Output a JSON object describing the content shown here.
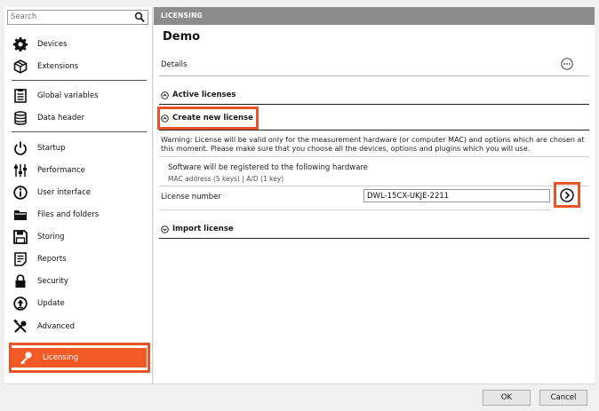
{
  "search": {
    "placeholder": "Search"
  },
  "sidebar": {
    "items": [
      {
        "label": "Devices",
        "icon": "gear-icon"
      },
      {
        "label": "Extensions",
        "icon": "package-icon"
      },
      {
        "label": "Global variables",
        "icon": "document-list-icon"
      },
      {
        "label": "Data header",
        "icon": "database-icon"
      },
      {
        "label": "Startup",
        "icon": "power-icon"
      },
      {
        "label": "Performance",
        "icon": "sliders-icon"
      },
      {
        "label": "User interface",
        "icon": "info-circle-icon"
      },
      {
        "label": "Files and folders",
        "icon": "folder-icon"
      },
      {
        "label": "Storing",
        "icon": "floppy-disk-icon"
      },
      {
        "label": "Reports",
        "icon": "report-icon"
      },
      {
        "label": "Security",
        "icon": "lock-icon"
      },
      {
        "label": "Update",
        "icon": "update-arrow-icon"
      },
      {
        "label": "Advanced",
        "icon": "tools-icon"
      },
      {
        "label": "Licensing",
        "icon": "key-icon"
      }
    ]
  },
  "main": {
    "header": "LICENSING",
    "title": "Demo",
    "details": "Details",
    "sections": {
      "active": "Active licenses",
      "create": "Create new license",
      "import": "Import license"
    },
    "warning": "Warning: License will be valid only for the measurement hardware (or computer MAC) and options which are chosen at this moment. Please make sure that you choose all the devices, options and plugins which you will use.",
    "hardware_text": "Software will be registered to the following hardware",
    "hardware_sub": "MAC address (5 keys) | A/D (1 key)",
    "license_label": "License number",
    "license_value": "DWL-15CX-UKJE-2211"
  },
  "footer": {
    "ok": "OK",
    "cancel": "Cancel"
  },
  "colors": {
    "accent": "#f15a24",
    "header_bg": "#8c8c8c"
  }
}
